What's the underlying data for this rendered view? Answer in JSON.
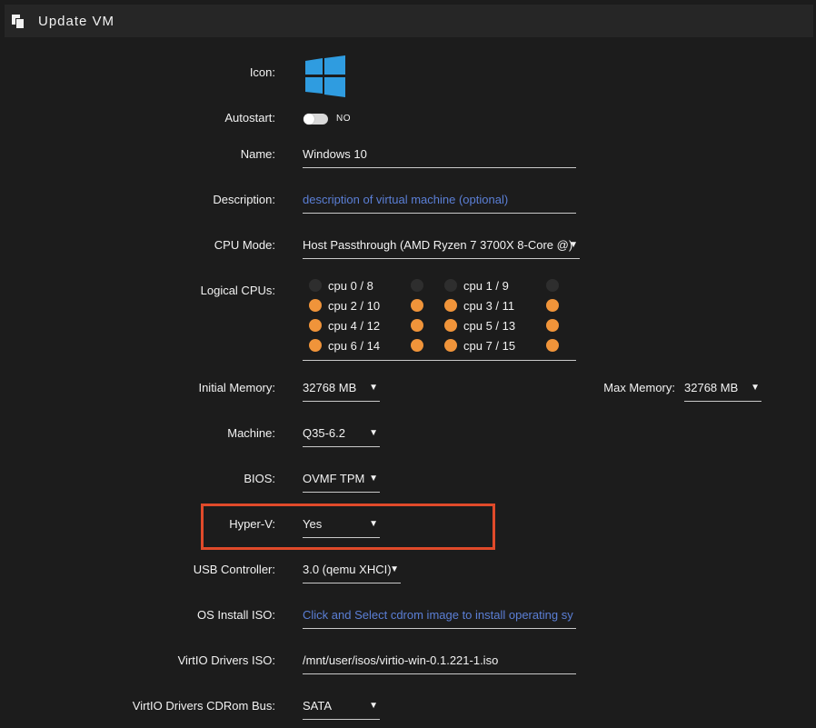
{
  "header": {
    "title": "Update VM",
    "icon": "copy-icon"
  },
  "form": {
    "icon_label": "Icon:",
    "icon_name": "windows-logo-icon",
    "autostart_label": "Autostart:",
    "autostart_value": "NO",
    "autostart_on": false,
    "name_label": "Name:",
    "name_value": "Windows 10",
    "description_label": "Description:",
    "description_placeholder": "description of virtual machine (optional)",
    "cpu_mode_label": "CPU Mode:",
    "cpu_mode_value": "Host Passthrough (AMD Ryzen 7 3700X 8-Core @)",
    "logical_cpus_label": "Logical CPUs:",
    "logical_cpus": [
      {
        "label": "cpu 0 / 8",
        "primary_on": false,
        "sibling_on": false
      },
      {
        "label": "cpu 1 / 9",
        "primary_on": false,
        "sibling_on": false
      },
      {
        "label": "cpu 2 / 10",
        "primary_on": true,
        "sibling_on": true
      },
      {
        "label": "cpu 3 / 11",
        "primary_on": true,
        "sibling_on": true
      },
      {
        "label": "cpu 4 / 12",
        "primary_on": true,
        "sibling_on": true
      },
      {
        "label": "cpu 5 / 13",
        "primary_on": true,
        "sibling_on": true
      },
      {
        "label": "cpu 6 / 14",
        "primary_on": true,
        "sibling_on": true
      },
      {
        "label": "cpu 7 / 15",
        "primary_on": true,
        "sibling_on": true
      }
    ],
    "initial_memory_label": "Initial Memory:",
    "initial_memory_value": "32768 MB",
    "max_memory_label": "Max Memory:",
    "max_memory_value": "32768 MB",
    "machine_label": "Machine:",
    "machine_value": "Q35-6.2",
    "bios_label": "BIOS:",
    "bios_value": "OVMF TPM",
    "hyperv_label": "Hyper-V:",
    "hyperv_value": "Yes",
    "usb_label": "USB Controller:",
    "usb_value": "3.0 (qemu XHCI)",
    "os_iso_label": "OS Install ISO:",
    "os_iso_placeholder": "Click and Select cdrom image to install operating sy",
    "virtio_iso_label": "VirtIO Drivers ISO:",
    "virtio_iso_value": "/mnt/user/isos/virtio-win-0.1.221-1.iso",
    "virtio_bus_label": "VirtIO Drivers CDRom Bus:",
    "virtio_bus_value": "SATA"
  },
  "colors": {
    "accent": "#f0943a",
    "link": "#5b7fd6",
    "highlight": "#e04a2a",
    "windows": "#2f9ce0"
  }
}
